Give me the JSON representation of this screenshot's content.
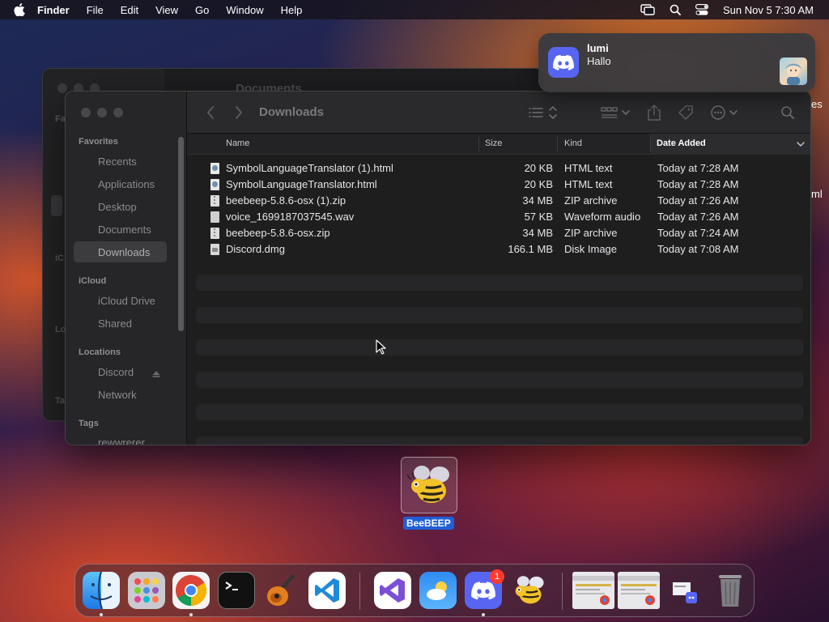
{
  "menubar": {
    "app_name": "Finder",
    "menus": [
      "File",
      "Edit",
      "View",
      "Go",
      "Window",
      "Help"
    ],
    "clock": "Sun Nov 5  7:30 AM",
    "icons": [
      "apple-icon",
      "screen-mirroring-icon",
      "search-icon",
      "control-center-icon"
    ]
  },
  "back_window": {
    "title": "Documents",
    "sidebar_ghosts": [
      "Fa",
      "iC",
      "Lo",
      "Ta"
    ]
  },
  "finder": {
    "title": "Downloads",
    "sidebar": {
      "favorites_label": "Favorites",
      "favorites": [
        "Recents",
        "Applications",
        "Desktop",
        "Documents",
        "Downloads"
      ],
      "selected": "Downloads",
      "icloud_label": "iCloud",
      "icloud": [
        "iCloud Drive",
        "Shared"
      ],
      "locations_label": "Locations",
      "locations": [
        "Discord",
        "Network"
      ],
      "tags_label": "Tags",
      "tags": [
        "rewwrerer"
      ]
    },
    "columns": {
      "name": "Name",
      "size": "Size",
      "kind": "Kind",
      "date_added": "Date Added"
    },
    "sorted_by": "Date Added",
    "files": [
      {
        "name": "SymbolLanguageTranslator (1).html",
        "size": "20 KB",
        "kind": "HTML text",
        "date": "Today at 7:28 AM",
        "icon": "html"
      },
      {
        "name": "SymbolLanguageTranslator.html",
        "size": "20 KB",
        "kind": "HTML text",
        "date": "Today at 7:28 AM",
        "icon": "html"
      },
      {
        "name": "beebeep-5.8.6-osx (1).zip",
        "size": "34 MB",
        "kind": "ZIP archive",
        "date": "Today at 7:26 AM",
        "icon": "zip"
      },
      {
        "name": "voice_1699187037545.wav",
        "size": "57 KB",
        "kind": "Waveform audio",
        "date": "Today at 7:26 AM",
        "icon": "wav"
      },
      {
        "name": "beebeep-5.8.6-osx.zip",
        "size": "34 MB",
        "kind": "ZIP archive",
        "date": "Today at 7:24 AM",
        "icon": "zip"
      },
      {
        "name": "Discord.dmg",
        "size": "166.1 MB",
        "kind": "Disk Image",
        "date": "Today at 7:08 AM",
        "icon": "dmg"
      }
    ]
  },
  "notification": {
    "app": "Discord",
    "title": "lumi",
    "body": "Hallo"
  },
  "desktop": {
    "edge_text_1": "es",
    "edge_text_2": "ml",
    "icon_label": "BeeBEEP"
  },
  "dock": {
    "apps": [
      "Finder",
      "Launchpad",
      "Google Chrome",
      "Terminal",
      "GarageBand",
      "Visual Studio Code",
      "Visual Studio",
      "Weather",
      "Discord",
      "BeeBEEP",
      "Chrome Window",
      "Chrome Window",
      "Discord Window",
      "Trash"
    ],
    "discord_badge": "1"
  },
  "colors": {
    "discord": "#5865f2",
    "selection_blue": "#1f5fd6",
    "badge_red": "#ff3b30"
  }
}
